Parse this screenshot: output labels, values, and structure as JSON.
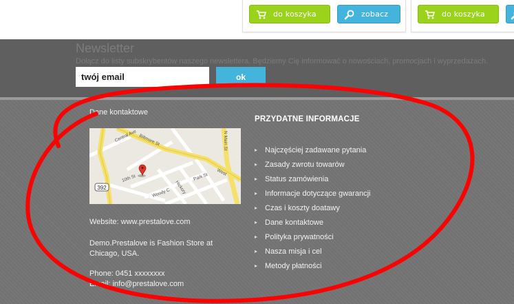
{
  "products": {
    "card1": {
      "cart_label": "do koszyka",
      "view_label": "zobacz"
    },
    "card2": {
      "cart_label": "do koszyka"
    }
  },
  "newsletter": {
    "title": "Newsletter",
    "description": "Dołącz do listy subskrybentów naszego newslettera. Będziemy Cię informować o nowościach, promocjach i wyprzedażach.",
    "email_value": "twój email",
    "submit_label": "ok"
  },
  "contact": {
    "heading": "Dane kontaktowe",
    "map_labels": {
      "central": "Central Ave",
      "biltmore": "Biltmore St",
      "main": "N Main St",
      "tenth": "10th St",
      "park": "Park St",
      "west": "West",
      "hickory": "Hickory",
      "woody": "Woody C",
      "route": "392"
    },
    "website": "Website: www.prestalove.com",
    "company": "Demo.Prestalove is Fashion Store at Chicago, USA.",
    "phone": "Phone: 0451 xxxxxxxx",
    "email": "Email: info@prestalove.com"
  },
  "info": {
    "heading": "PRZYDATNE INFORMACJE",
    "items": [
      "Najczęściej zadawane pytania",
      "Zasady zwrotu towarów",
      "Status zamówienia",
      "Informacje dotyczące gwarancji",
      "Czas i koszty doatawy",
      "Dane kontaktowe",
      "Polityka prywatności",
      "Nasza misja i cel",
      "Metody płatności"
    ]
  },
  "colors": {
    "green_button": "#9ad21c",
    "blue_button": "#45b4dd",
    "annotation_red": "#ff0000"
  },
  "icons": {
    "cart": "cart-icon",
    "magnifier": "search-icon",
    "map_pin": "map-pin-icon"
  }
}
